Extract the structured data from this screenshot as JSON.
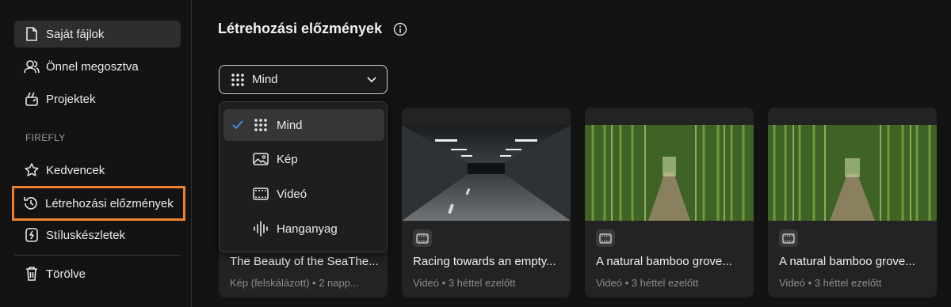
{
  "sidebar": {
    "items": [
      {
        "label": "Saját fájlok",
        "icon": "file-icon"
      },
      {
        "label": "Önnel megosztva",
        "icon": "people-icon"
      },
      {
        "label": "Projektek",
        "icon": "projects-icon"
      }
    ],
    "section_label": "FIREFLY",
    "firefly_items": [
      {
        "label": "Kedvencek",
        "icon": "star-icon"
      },
      {
        "label": "Létrehozási előzmények",
        "icon": "history-icon"
      },
      {
        "label": "Stíluskészletek",
        "icon": "style-kit-icon"
      }
    ],
    "trash": {
      "label": "Törölve",
      "icon": "trash-icon"
    }
  },
  "header": {
    "title": "Létrehozási előzmények"
  },
  "filter": {
    "selected": "Mind",
    "options": [
      {
        "label": "Mind",
        "icon": "grid-icon",
        "checked": true
      },
      {
        "label": "Kép",
        "icon": "image-icon",
        "checked": false
      },
      {
        "label": "Videó",
        "icon": "video-icon",
        "checked": false
      },
      {
        "label": "Hanganyag",
        "icon": "audio-icon",
        "checked": false
      }
    ]
  },
  "cards": [
    {
      "title": "The Beauty of the SeaThe...",
      "meta": "Kép (felskálázott) • 2 napp..."
    },
    {
      "title": "Racing towards an empty...",
      "meta": "Videó • 3 héttel ezelőtt"
    },
    {
      "title": "A natural bamboo grove...",
      "meta": "Videó • 3 héttel ezelőtt"
    },
    {
      "title": "A natural bamboo grove...",
      "meta": "Videó • 3 héttel ezelőtt"
    }
  ],
  "colors": {
    "accent": "#4b8cf7",
    "highlight": "#f0812a"
  }
}
